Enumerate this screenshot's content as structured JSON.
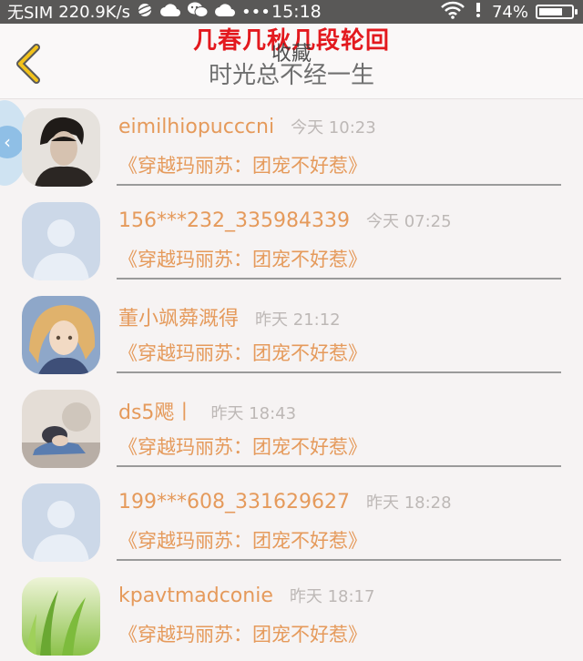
{
  "status_bar": {
    "carrier": "无SIM",
    "speed": "220.9K/s",
    "time": "15:18",
    "dots": "•••",
    "battery": "74%",
    "battery_level": 0.74,
    "icons": [
      "planet-icon",
      "cloud-icon",
      "wechat-icon",
      "cloud-icon",
      "wifi-icon",
      "alarm-icon",
      "battery-icon"
    ]
  },
  "header": {
    "overlay_title": "几春几秋几段轮回",
    "title": "收藏",
    "subtitle": "时光总不经一生",
    "back_icon": "chevron-left-icon"
  },
  "items": [
    {
      "name": "eimilhiopucccni",
      "time": "今天 10:23",
      "book": "《穿越玛丽苏：团宠不好惹》",
      "avatar": "portrait-boy"
    },
    {
      "name": "156***232_335984339",
      "time": "今天 07:25",
      "book": "《穿越玛丽苏：团宠不好惹》",
      "avatar": "default-user"
    },
    {
      "name": "董小飒蕣溉得",
      "time": "昨天 21:12",
      "book": "《穿越玛丽苏：团宠不好惹》",
      "avatar": "anime-girl"
    },
    {
      "name": "ds5飔丨",
      "time": "昨天 18:43",
      "book": "《穿越玛丽苏：团宠不好惹》",
      "avatar": "sleeping-boy"
    },
    {
      "name": "199***608_331629627",
      "time": "昨天 18:28",
      "book": "《穿越玛丽苏：团宠不好惹》",
      "avatar": "default-user"
    },
    {
      "name": "kpavtmadconie",
      "time": "昨天 18:17",
      "book": "《穿越玛丽苏：团宠不好惹》",
      "avatar": "green-grass"
    }
  ],
  "colors": {
    "accent": "#e59a5b",
    "overlay_red": "#e3191e",
    "status_bar": "#595857",
    "back_icon": "#f2c21b"
  }
}
